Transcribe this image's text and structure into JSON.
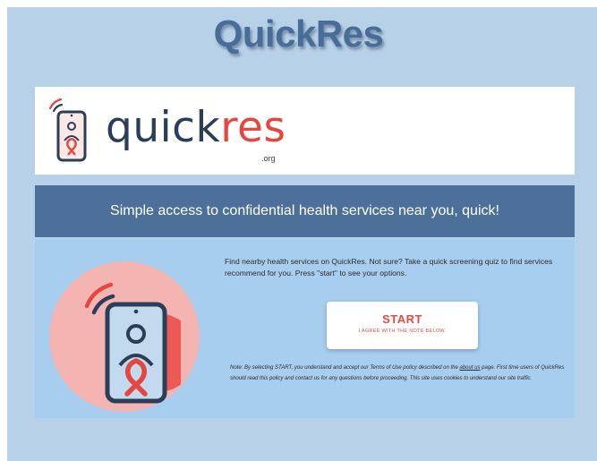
{
  "header": {
    "title": "QuickRes"
  },
  "logo": {
    "quick": "quick",
    "res": "res",
    "org": ".org",
    "icon": "phone-ribbon-icon"
  },
  "tagline": "Simple access to confidential health services near you, quick!",
  "intro": "Find nearby health services on QuickRes. Not sure? Take a quick screening quiz to find services recommend for you. Press \"start\" to see your options.",
  "start_button": {
    "label": "START",
    "sublabel": "I AGREE WITH THE NOTE BELOW."
  },
  "note": {
    "before_link": "Note: By selecting START, you understand and accept our Terms of Use policy described on the ",
    "link": "about us",
    "after_link": " page. First time users of QuickRes should read this policy and contact us for any questions before proceeding. This site uses cookies to understand our site traffic."
  },
  "colors": {
    "background": "#b6d1e8",
    "brand_navy": "#2b3e58",
    "brand_red": "#e4473f",
    "band_blue": "#4c7099",
    "circle_pink": "#f4b4b2"
  }
}
